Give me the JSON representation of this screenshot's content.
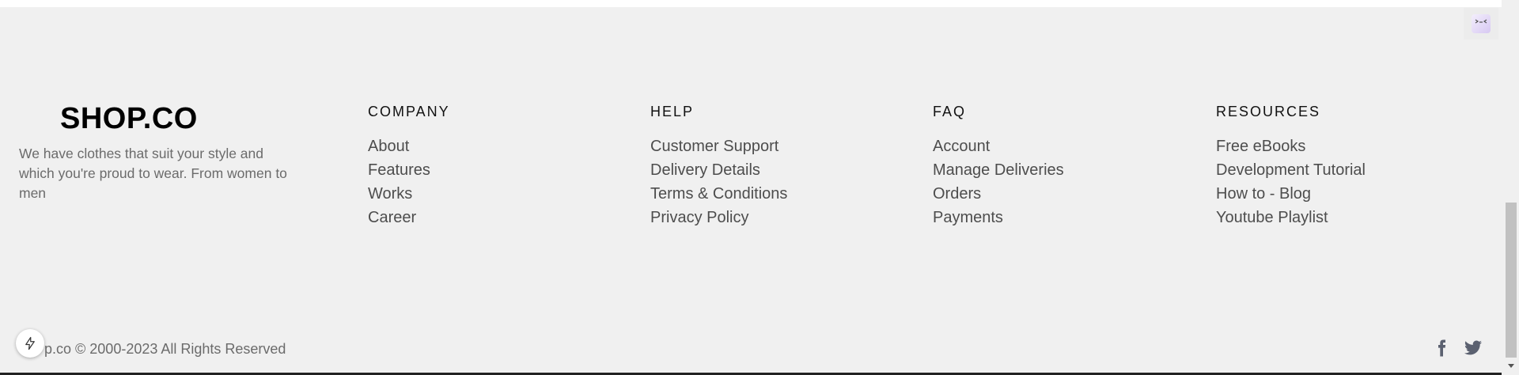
{
  "brand": {
    "logo": "SHOP.CO",
    "tagline": "We have clothes that suit your style and which you're proud to wear. From women to men"
  },
  "columns": [
    {
      "title": "COMPANY",
      "links": [
        "About",
        "Features",
        "Works",
        "Career"
      ]
    },
    {
      "title": "HELP",
      "links": [
        "Customer Support",
        "Delivery Details",
        "Terms & Conditions",
        "Privacy Policy"
      ]
    },
    {
      "title": "FAQ",
      "links": [
        "Account",
        "Manage Deliveries",
        "Orders",
        "Payments"
      ]
    },
    {
      "title": "RESOURCES",
      "links": [
        "Free eBooks",
        "Development Tutorial",
        "How to - Blog",
        "Youtube Playlist"
      ]
    }
  ],
  "footer": {
    "copyright": "p.co © 2000-2023 All Rights Reserved"
  },
  "icons": {
    "facebook": "facebook-icon",
    "twitter": "twitter-icon",
    "bolt": "bolt-icon"
  },
  "colors": {
    "background": "#f0f0f0",
    "link": "#4d4d4d",
    "muted": "#6b6b6b"
  }
}
